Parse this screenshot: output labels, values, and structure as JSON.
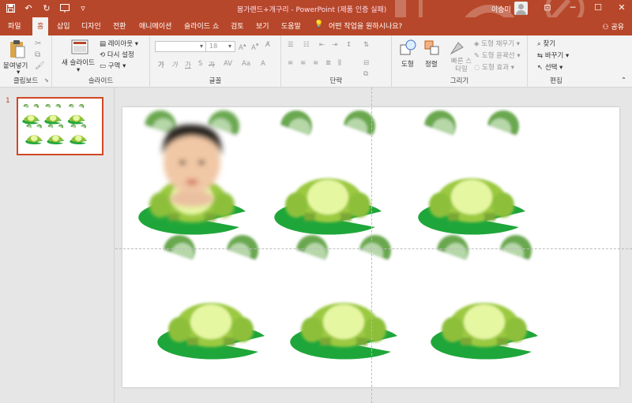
{
  "titlebar": {
    "title": "봄가랜드+개구리 - PowerPoint (제품 인증 실패)",
    "user_name": "이승미"
  },
  "tabs": [
    "파일",
    "홈",
    "삽입",
    "디자인",
    "전환",
    "애니메이션",
    "슬라이드 쇼",
    "검토",
    "보기",
    "도움말"
  ],
  "tell_me": "어떤 작업을 원하시나요?",
  "share": "공유",
  "ribbon": {
    "clipboard": {
      "label": "클립보드",
      "paste": "붙여넣기"
    },
    "slides": {
      "label": "슬라이드",
      "new_slide": "새 슬라이드",
      "layout": "레이아웃",
      "reset": "다시 설정",
      "section": "구역"
    },
    "font": {
      "label": "글꼴",
      "font_name": "",
      "font_size": "18",
      "bold": "가",
      "italic": "가",
      "underline": "가",
      "strike": "가",
      "spacing": "AV",
      "case": "Aa"
    },
    "paragraph": {
      "label": "단락"
    },
    "drawing": {
      "label": "그리기",
      "shapes": "도형",
      "arrange": "정렬",
      "quick_styles": "빠른 스타일",
      "fill": "도형 채우기",
      "outline": "도형 윤곽선",
      "effects": "도형 효과"
    },
    "editing": {
      "label": "편집",
      "find": "찾기",
      "replace": "바꾸기",
      "select": "선택"
    }
  },
  "slide_panel": {
    "slide_number": "1"
  },
  "colors": {
    "accent": "#b7472a",
    "frog_dark": "#6aa84f",
    "frog_light": "#b6d7a8",
    "frog_body": "#9bc93f",
    "frog_belly": "#e6f7a1",
    "lily_pad": "#1fa63a"
  }
}
